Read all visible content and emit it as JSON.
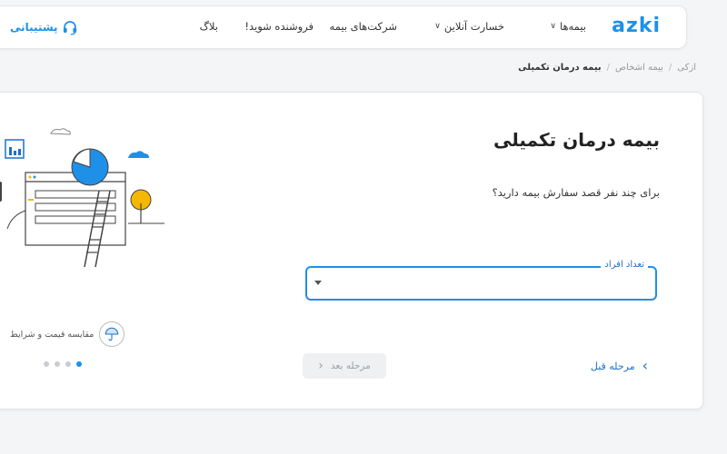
{
  "header": {
    "logo": "azki",
    "nav": [
      {
        "label": "بیمه‌ها"
      },
      {
        "label": "خسارت آنلاین"
      },
      {
        "label": "شرکت‌های بیمه"
      },
      {
        "label": "فروشنده شوید!"
      },
      {
        "label": "بلاگ"
      }
    ],
    "support_label": "پشتیبانی"
  },
  "breadcrumb": [
    "ازکی",
    "بیمه اشخاص",
    "بیمه درمان تکمیلی"
  ],
  "main": {
    "title": "بیمه درمان تکمیلی",
    "question": "برای چند نفر قصد سفارش بیمه دارید؟",
    "field": {
      "label": "تعداد افراد",
      "value": ""
    },
    "prev_button": "مرحله قبل",
    "next_button": "مرحله بعد",
    "compare_text": "مقایسه قیمت و شرایط",
    "carousel": {
      "count": 4,
      "active": 0
    }
  },
  "colors": {
    "accent": "#1e90e8",
    "illustration_accent": "#f5b800"
  }
}
